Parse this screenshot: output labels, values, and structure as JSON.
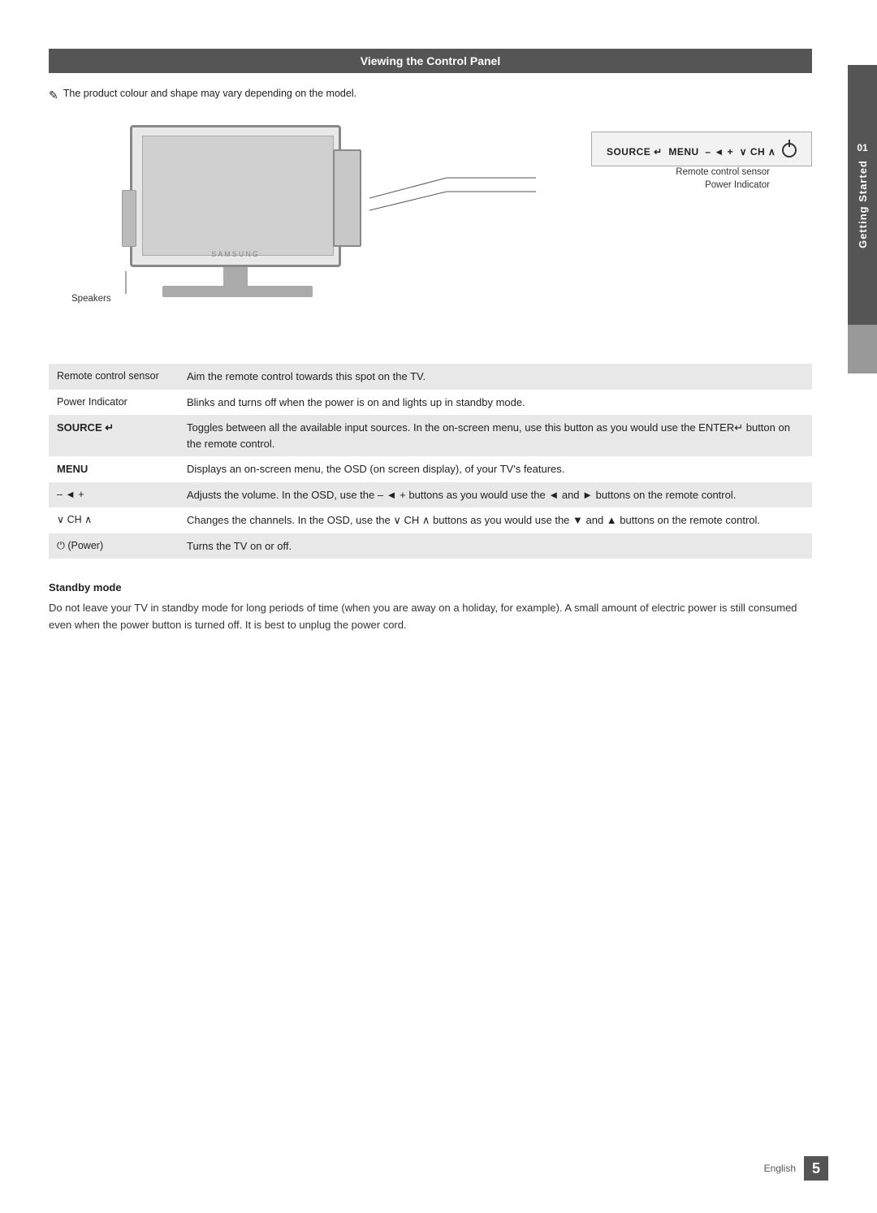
{
  "page": {
    "title": "Viewing the Control Panel",
    "note": "The product colour and shape may vary depending on the model.",
    "note_icon": "✎",
    "section_number": "01",
    "section_title": "Getting Started"
  },
  "diagram": {
    "callouts": {
      "remote_sensor": "Remote control sensor",
      "power_indicator": "Power Indicator",
      "speakers": "Speakers"
    },
    "control_panel": "SOURCE    MENU  –  ◄ +  ∨ CH ∧  ⏻",
    "brand": "SAMSUNG"
  },
  "table": {
    "rows": [
      {
        "label": "Remote control sensor",
        "label_bold": false,
        "description": "Aim the remote control towards this spot on the TV."
      },
      {
        "label": "Power Indicator",
        "label_bold": false,
        "description": "Blinks and turns off when the power is on and lights up in standby mode."
      },
      {
        "label": "SOURCE  ↵",
        "label_bold": true,
        "description": "Toggles between all the available input sources. In the on-screen menu, use this button as you would use the ENTER↵ button on the remote control."
      },
      {
        "label": "MENU",
        "label_bold": true,
        "description": "Displays an on-screen menu, the OSD (on screen display), of your TV's features."
      },
      {
        "label": "– ◄ +",
        "label_bold": false,
        "description": "Adjusts the volume. In the OSD, use the – ◄ + buttons as you would use the ◄ and ► buttons on the remote control."
      },
      {
        "label": "∨ CH ∧",
        "label_bold": false,
        "description": "Changes the channels. In the OSD, use the ∨ CH ∧ buttons as you would use the ▼ and ▲ buttons on the remote control."
      },
      {
        "label": "⏻ (Power)",
        "label_bold": false,
        "description": "Turns the TV on or off."
      }
    ]
  },
  "standby": {
    "title": "Standby mode",
    "text": "Do not leave your TV in standby mode for long periods of time (when you are away on a holiday, for example). A small amount of electric power is still consumed even when the power button is turned off. It is best to unplug the power cord."
  },
  "footer": {
    "language": "English",
    "page_number": "5"
  }
}
